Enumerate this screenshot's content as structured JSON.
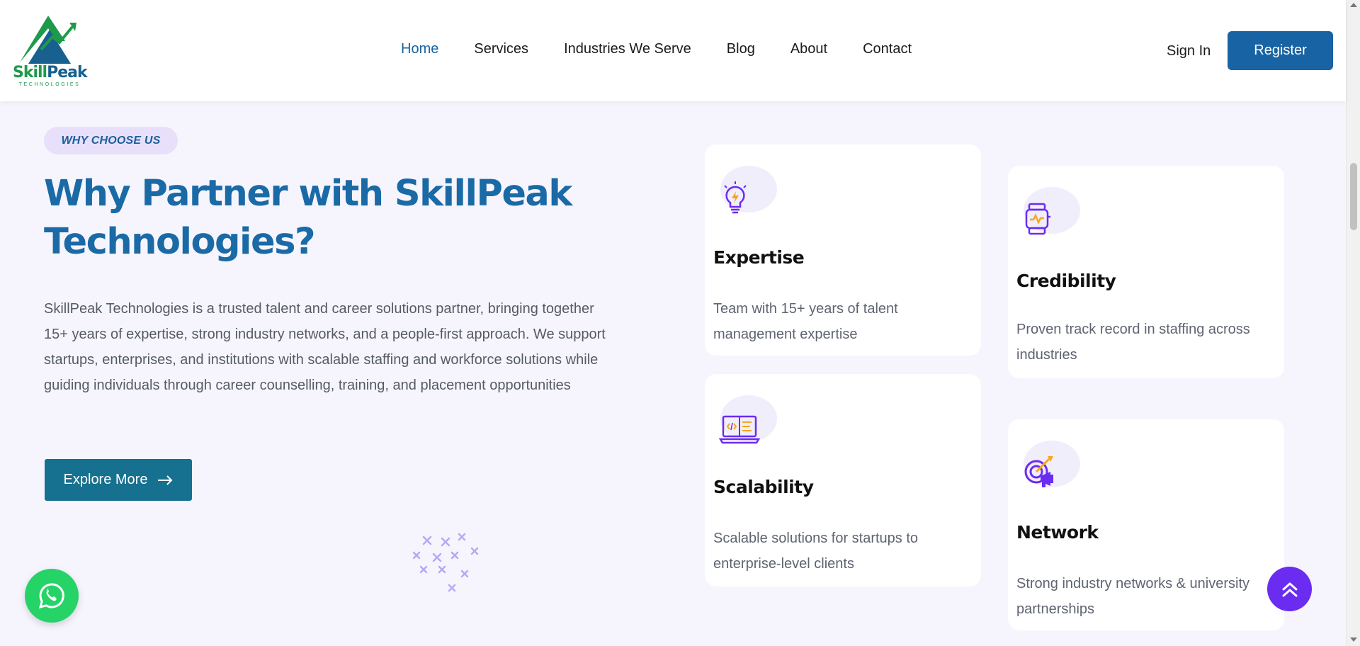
{
  "brand": {
    "name_part1": "Skill",
    "name_part2": "Peak",
    "subtitle": "TECHNOLOGIES"
  },
  "nav": {
    "items": [
      {
        "label": "Home",
        "active": true
      },
      {
        "label": "Services",
        "active": false
      },
      {
        "label": "Industries We Serve",
        "active": false
      },
      {
        "label": "Blog",
        "active": false
      },
      {
        "label": "About",
        "active": false
      },
      {
        "label": "Contact",
        "active": false
      }
    ],
    "sign_in": "Sign In",
    "register": "Register"
  },
  "hero": {
    "badge": "WHY CHOOSE US",
    "title": "Why Partner with SkillPeak Technologies?",
    "description": "SkillPeak Technologies is a trusted talent and career solutions partner, bringing together 15+ years of expertise, strong industry networks, and a people-first approach. We support startups, enterprises, and institutions with scalable staffing and workforce solutions while guiding individuals through career counselling, training, and placement opportunities",
    "cta": "Explore More"
  },
  "cards": [
    {
      "title": "Expertise",
      "text": "Team with 15+ years of talent management expertise",
      "icon": "lightbulb-icon"
    },
    {
      "title": "Credibility",
      "text": "Proven track record in staffing across industries",
      "icon": "smartwatch-icon"
    },
    {
      "title": "Scalability",
      "text": "Scalable solutions for startups to enterprise-level clients",
      "icon": "laptop-code-icon"
    },
    {
      "title": "Network",
      "text": "Strong industry networks & university partnerships",
      "icon": "target-megaphone-icon"
    }
  ],
  "colors": {
    "primary": "#1863a3",
    "accent": "#6a2cf0",
    "whatsapp": "#25d366",
    "background": "#f6f5fd"
  }
}
